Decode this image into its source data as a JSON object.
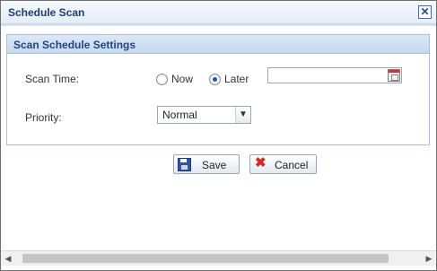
{
  "dialog": {
    "title": "Schedule Scan",
    "close_glyph": "✕"
  },
  "panel": {
    "header": "Scan Schedule Settings",
    "scan_time": {
      "label": "Scan Time:",
      "options": [
        {
          "label": "Now",
          "checked": false
        },
        {
          "label": "Later",
          "checked": true
        }
      ],
      "date_value": "",
      "calendar_icon": "calendar-icon"
    },
    "priority": {
      "label": "Priority:",
      "selected": "Normal",
      "arrow_glyph": "▼"
    }
  },
  "buttons": {
    "save": {
      "label": "Save",
      "icon": "floppy-disk-icon"
    },
    "cancel": {
      "label": "Cancel",
      "icon": "red-x-icon",
      "glyph": "✖"
    }
  },
  "scrollbar": {
    "left_glyph": "◀",
    "right_glyph": "▶"
  },
  "colors": {
    "title_text": "#1f3d6e",
    "panel_header_bg": "#c6d9ef",
    "accent_blue": "#1a5aa8",
    "cancel_red": "#d42a2a"
  }
}
